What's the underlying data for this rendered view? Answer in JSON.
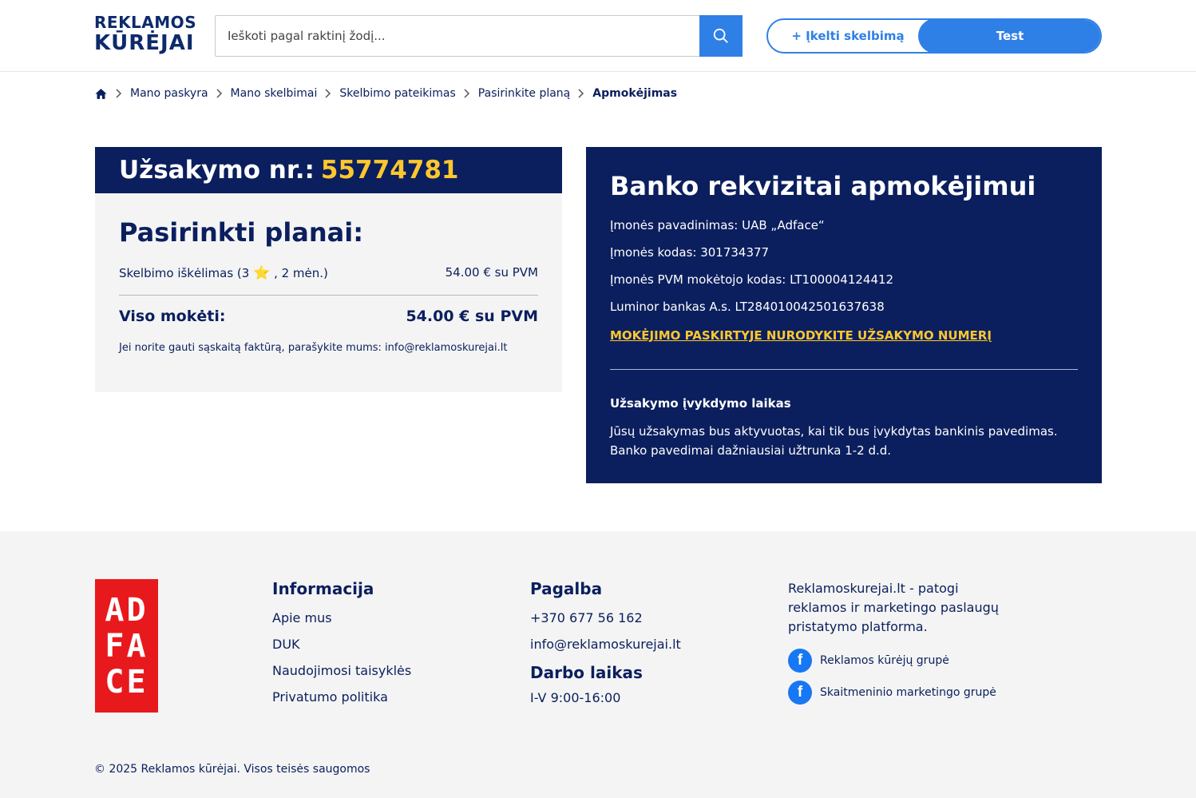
{
  "header": {
    "logo_line1": "REKLAMOS",
    "logo_line2": "KŪRĖJAI",
    "search_placeholder": "Ieškoti pagal raktinį žodį...",
    "upload_label": "+ Įkelti skelbimą",
    "user_label": "Test"
  },
  "breadcrumb": {
    "items": [
      "Mano paskyra",
      "Mano skelbimai",
      "Skelbimo pateikimas",
      "Pasirinkite planą"
    ],
    "current": "Apmokėjimas"
  },
  "order": {
    "title_prefix": "Užsakymo nr.:",
    "number": "55774781",
    "plans_heading": "Pasirinkti planai:",
    "plan_name_before": "Skelbimo iškėlimas (3",
    "plan_star": "⭐",
    "plan_name_after": ", 2 mėn.)",
    "plan_price": "54.00 € su PVM",
    "total_label": "Viso mokėti:",
    "total_value": "54.00 € su PVM",
    "invoice_note": "Jei norite gauti sąskaitą faktūrą, parašykite mums: info@reklamoskurejai.lt"
  },
  "bank": {
    "title": "Banko rekvizitai apmokėjimui",
    "company_name": "Įmonės pavadinimas: UAB „Adface“",
    "company_code": "Įmonės kodas: 301734377",
    "vat_code": "Įmonės PVM mokėtojo kodas: LT100004124412",
    "account": "Luminor bankas A.s. LT284010042501637638",
    "notice": "MOKĖJIMO PASKIRTYJE NURODYKITE UŽSAKYMO NUMERĮ",
    "exec_heading": "Užsakymo įvykdymo laikas",
    "exec_line1": "Jūsų užsakymas bus aktyvuotas, kai tik bus įvykdytas bankinis pavedimas.",
    "exec_line2": "Banko pavedimai dažniausiai užtrunka 1-2 d.d."
  },
  "footer": {
    "brand_letters": [
      "AD",
      "FA",
      "CE"
    ],
    "info_heading": "Informacija",
    "info_links": [
      "Apie mus",
      "DUK",
      "Naudojimosi taisyklės",
      "Privatumo politika"
    ],
    "help_heading": "Pagalba",
    "phone": "+370 677 56 162",
    "email": "info@reklamoskurejai.lt",
    "hours_heading": "Darbo laikas",
    "hours": "I-V 9:00-16:00",
    "about": "Reklamoskurejai.lt - patogi reklamos ir marketingo paslaugų pristatymo platforma.",
    "fb_group1": "Reklamos kūrėjų grupė",
    "fb_group2": "Skaitmeninio marketingo grupė",
    "copyright": "© 2025 Reklamos kūrėjai. Visos teisės saugomos"
  },
  "colors": {
    "navy": "#0b1f5e",
    "accent_blue": "#2f80e6",
    "yellow": "#ffc72c",
    "adface_red": "#e8191d",
    "footer_bg": "#f4f4f4"
  }
}
